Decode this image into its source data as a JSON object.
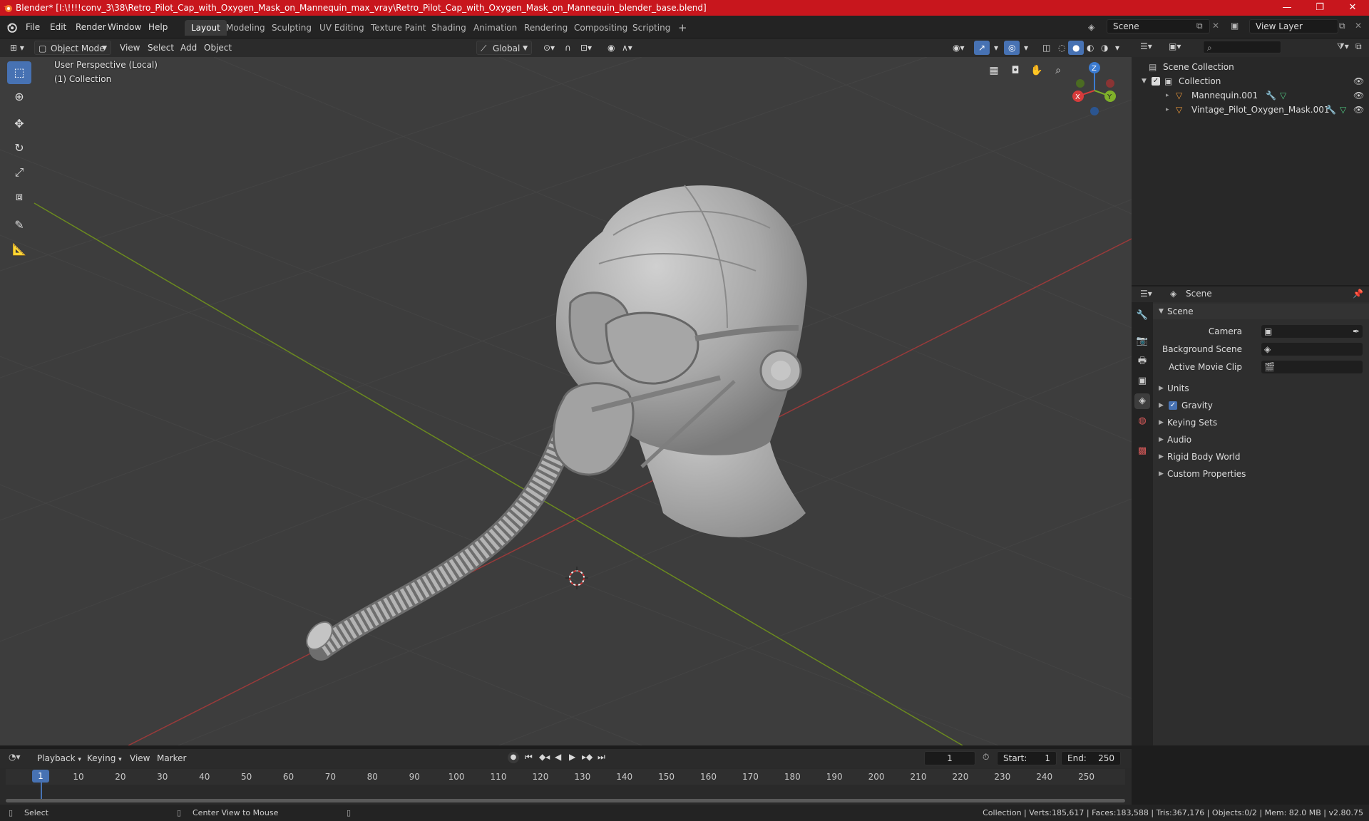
{
  "window": {
    "title": "Blender* [I:\\!!!!conv_3\\38\\Retro_Pilot_Cap_with_Oxygen_Mask_on_Mannequin_max_vray\\Retro_Pilot_Cap_with_Oxygen_Mask_on_Mannequin_blender_base.blend]",
    "minimize": "—",
    "maximize": "❐",
    "close": "✕"
  },
  "menus": [
    "File",
    "Edit",
    "Render",
    "Window",
    "Help"
  ],
  "workspaces": [
    {
      "label": "Layout",
      "active": true
    },
    {
      "label": "Modeling"
    },
    {
      "label": "Sculpting"
    },
    {
      "label": "UV Editing"
    },
    {
      "label": "Texture Paint"
    },
    {
      "label": "Shading"
    },
    {
      "label": "Animation"
    },
    {
      "label": "Rendering"
    },
    {
      "label": "Compositing"
    },
    {
      "label": "Scripting"
    }
  ],
  "add_workspace": "+",
  "scene_field": "Scene",
  "viewlayer_field": "View Layer",
  "viewport_header": {
    "mode": "Object Mode",
    "view": "View",
    "select": "Select",
    "add": "Add",
    "object": "Object",
    "transform": "Global"
  },
  "viewport": {
    "perspective": "User Perspective (Local)",
    "collection": "(1) Collection",
    "gizmo": {
      "x": "X",
      "y": "Y",
      "z": "Z"
    }
  },
  "outliner": {
    "root": "Scene Collection",
    "collection": "Collection",
    "objects": [
      "Mannequin.001",
      "Vintage_Pilot_Oxygen_Mask.001"
    ]
  },
  "properties": {
    "context": "Scene",
    "panel": "Scene",
    "camera_label": "Camera",
    "bg_scene_label": "Background Scene",
    "movie_clip_label": "Active Movie Clip",
    "sections": [
      "Units",
      "Gravity",
      "Keying Sets",
      "Audio",
      "Rigid Body World",
      "Custom Properties"
    ]
  },
  "timeline": {
    "playback": "Playback",
    "keying": "Keying",
    "view": "View",
    "marker": "Marker",
    "current_frame": "1",
    "start_label": "Start:",
    "start": "1",
    "end_label": "End:",
    "end": "250",
    "ticks": [
      "1",
      "10",
      "20",
      "30",
      "40",
      "50",
      "60",
      "70",
      "80",
      "90",
      "100",
      "110",
      "120",
      "130",
      "140",
      "150",
      "160",
      "170",
      "180",
      "190",
      "200",
      "210",
      "220",
      "230",
      "240",
      "250"
    ]
  },
  "status": {
    "select": "Select",
    "center": "Center View to Mouse",
    "stats": "Collection | Verts:185,617 | Faces:183,588 | Tris:367,176 | Objects:0/2 | Mem: 82.0 MB | v2.80.75"
  }
}
